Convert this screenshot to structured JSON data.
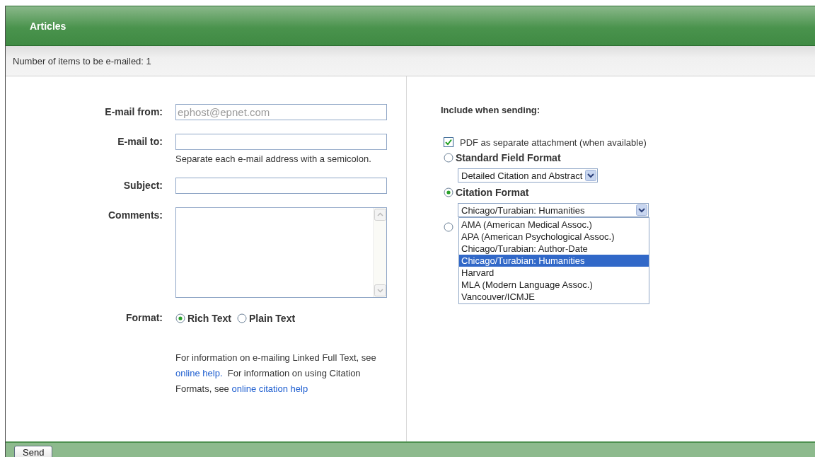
{
  "header": {
    "title": "Articles"
  },
  "info_bar": {
    "text": "Number of items to be e-mailed: 1"
  },
  "form": {
    "fields": [
      {
        "kind": "input",
        "label": "E-mail from:",
        "value": "ephost@epnet.com",
        "disabled": true
      },
      {
        "kind": "input",
        "label": "E-mail to:",
        "hint": "Separate each e-mail address with a semicolon."
      },
      {
        "kind": "input",
        "label": "Subject:"
      },
      {
        "kind": "textarea",
        "label": "Comments:"
      }
    ],
    "format": {
      "label": "Format:",
      "options": [
        {
          "label": "Rich Text",
          "selected": true
        },
        {
          "label": "Plain Text",
          "selected": false
        }
      ]
    },
    "help": [
      {
        "kind": "text",
        "text": "For information on e-mailing Linked Full Text, see "
      },
      {
        "kind": "link",
        "text": "online help."
      },
      {
        "kind": "text",
        "text": "  For information on using Citation Formats, see "
      },
      {
        "kind": "link",
        "text": "online citation help"
      }
    ]
  },
  "include": {
    "heading": "Include when sending:",
    "pdf": {
      "label": "PDF as separate attachment (when available)",
      "checked": true
    },
    "formats": [
      {
        "label": "Standard Field Format",
        "selected": false,
        "select": {
          "value": "Detailed Citation and Abstract",
          "expanded": false
        }
      },
      {
        "label": "Citation Format",
        "selected": true,
        "select": {
          "value": "Chicago/Turabian: Humanities",
          "expanded": true,
          "options": [
            {
              "label": "AMA (American Medical Assoc.)",
              "selected": false
            },
            {
              "label": "APA (American Psychological Assoc.)",
              "selected": false
            },
            {
              "label": "Chicago/Turabian: Author-Date",
              "selected": false
            },
            {
              "label": "Chicago/Turabian: Humanities",
              "selected": true
            },
            {
              "label": "Harvard",
              "selected": false
            },
            {
              "label": "MLA (Modern Language Assoc.)",
              "selected": false
            },
            {
              "label": "Vancouver/ICMJE",
              "selected": false
            }
          ]
        }
      },
      {
        "selected": false
      }
    ]
  },
  "footer": {
    "button": "Send"
  }
}
